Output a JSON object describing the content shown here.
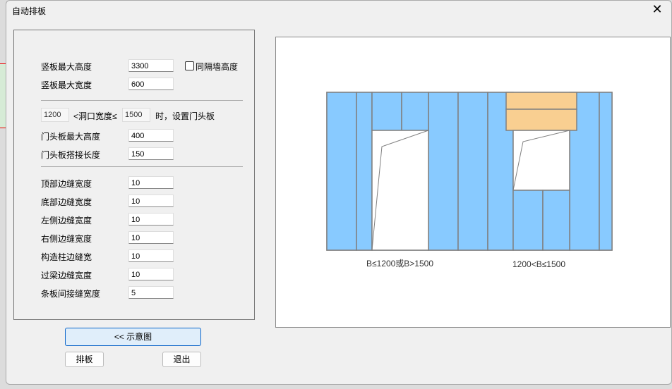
{
  "window": {
    "title": "自动排板"
  },
  "panel": {
    "max_height_label": "竖板最大高度",
    "max_height": "3300",
    "same_wall_label": "同隔墙高度",
    "same_wall_checked": false,
    "max_width_label": "竖板最大宽度",
    "max_width": "600",
    "door_min": "1200",
    "door_range_label": "<洞口宽度≤",
    "door_max": "1500",
    "door_suffix": "时，设置门头板",
    "header_max_height_label": "门头板最大高度",
    "header_max_height": "400",
    "header_overlap_label": "门头板搭接长度",
    "header_overlap": "150",
    "gaps": [
      {
        "label": "顶部边缝宽度",
        "value": "10"
      },
      {
        "label": "底部边缝宽度",
        "value": "10"
      },
      {
        "label": "左侧边缝宽度",
        "value": "10"
      },
      {
        "label": "右侧边缝宽度",
        "value": "10"
      },
      {
        "label": "构造柱边缝宽",
        "value": "10"
      },
      {
        "label": "过梁边缝宽度",
        "value": "10"
      },
      {
        "label": "条板间接缝宽度",
        "value": "5"
      }
    ]
  },
  "buttons": {
    "diagram": "<< 示意图",
    "layout": "排板",
    "exit": "退出"
  },
  "diagram": {
    "caption_left": "B≤1200或B>1500",
    "caption_right": "1200<B≤1500",
    "colors": {
      "panel": "#88caff",
      "header": "#f9cf91",
      "stroke": "#808080"
    }
  }
}
